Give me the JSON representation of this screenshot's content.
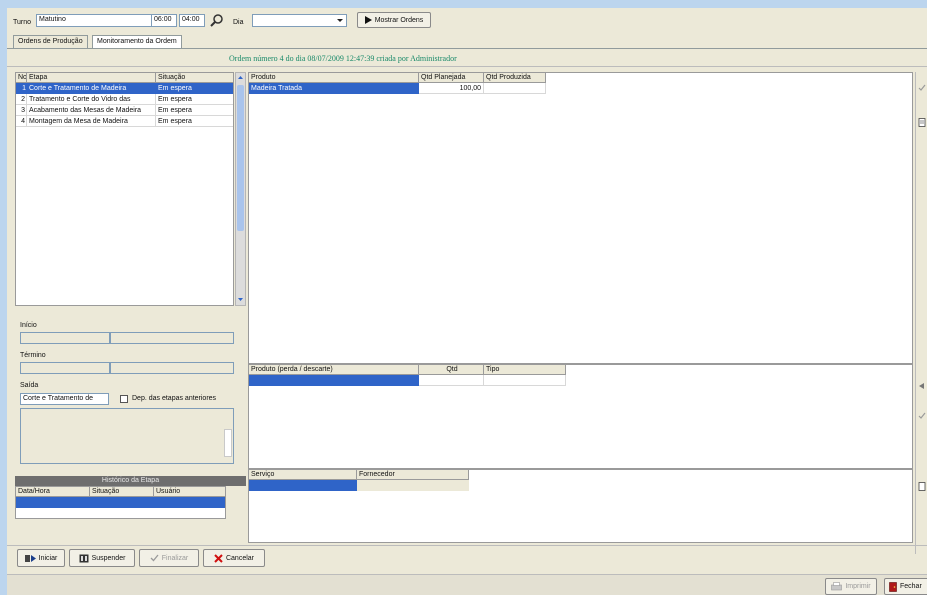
{
  "toolbar": {
    "turno_label": "Turno",
    "turno_value": "Matutino",
    "hora_inicio": "06:00",
    "hora_fim": "04:00",
    "dia_label": "Dia",
    "dia_value": "",
    "mostrar_label": "Mostrar Ordens"
  },
  "tabs": [
    {
      "label": "Ordens de Produção"
    },
    {
      "label": "Monitoramento da Ordem"
    }
  ],
  "order_title": "Ordem número 4 do dia 08/07/2009 12:47:39 criada por Administrador",
  "etapas": {
    "headers": {
      "no": "No",
      "etapa": "Etapa",
      "situacao": "Situação"
    },
    "rows": [
      {
        "no": "1",
        "etapa": "Corte e Tratamento de Madeira",
        "situacao": "Em espera"
      },
      {
        "no": "2",
        "etapa": "Tratamento e Corte do Vidro das",
        "situacao": "Em espera"
      },
      {
        "no": "3",
        "etapa": "Acabamento das Mesas de Madeira",
        "situacao": "Em espera"
      },
      {
        "no": "4",
        "etapa": "Montagem da Mesa de Madeira",
        "situacao": "Em espera"
      }
    ]
  },
  "produtos": {
    "headers": {
      "produto": "Produto",
      "qtd_planejada": "Qtd Planejada",
      "qtd_produzida": "Qtd Produzida"
    },
    "rows": [
      {
        "produto": "Madeira Tratada",
        "qtd_planejada": "100,00",
        "qtd_produzida": ""
      }
    ]
  },
  "details": {
    "inicio_label": "Início",
    "termino_label": "Término",
    "saida_label": "Saída",
    "saida_value": "Corte e Tratamento de",
    "dep_label": "Dep. das etapas anteriores"
  },
  "historico": {
    "title": "Histórico da Etapa",
    "headers": {
      "data_hora": "Data/Hora",
      "situacao": "Situação",
      "usuario": "Usuário"
    }
  },
  "perdas": {
    "headers": {
      "produto": "Produto (perda / descarte)",
      "qtd": "Qtd",
      "tipo": "Tipo"
    }
  },
  "servicos": {
    "headers": {
      "servico": "Serviço",
      "fornecedor": "Fornecedor"
    }
  },
  "actions": {
    "iniciar": "Iniciar",
    "suspender": "Suspender",
    "finalizar": "Finalizar",
    "cancelar": "Cancelar"
  },
  "footer": {
    "imprimir": "Imprimir",
    "fechar": "Fechar"
  },
  "colors": {
    "selection": "#2f64c8",
    "title_text": "#1a8a6a",
    "historico_header": "#6e6e6e"
  }
}
